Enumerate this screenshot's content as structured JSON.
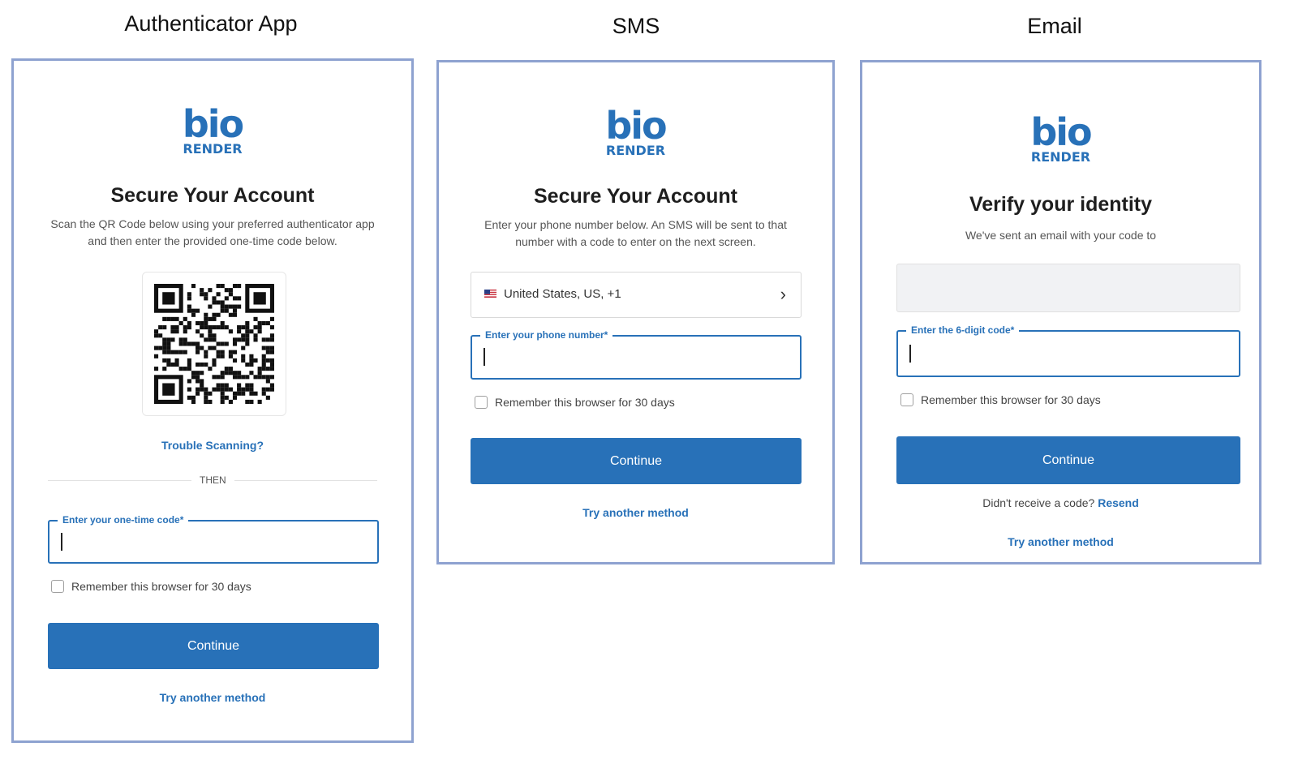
{
  "columns": {
    "authenticator": {
      "title": "Authenticator App",
      "logo": {
        "word": "bio",
        "sub": "RENDER"
      },
      "heading": "Secure Your Account",
      "description": "Scan the QR Code below using your preferred authenticator app and then enter the provided one-time code below.",
      "trouble_link": "Trouble Scanning?",
      "divider_text": "THEN",
      "code_field_label": "Enter your one-time code*",
      "remember_label": "Remember this browser for 30 days",
      "continue_label": "Continue",
      "another_method_link": "Try another method"
    },
    "sms": {
      "title": "SMS",
      "logo": {
        "word": "bio",
        "sub": "RENDER"
      },
      "heading": "Secure Your Account",
      "description": "Enter your phone number below. An SMS will be sent to that number with a code to enter on the next screen.",
      "country_select": "United States, US, +1",
      "phone_field_label": "Enter your phone number*",
      "remember_label": "Remember this browser for 30 days",
      "continue_label": "Continue",
      "another_method_link": "Try another method"
    },
    "email": {
      "title": "Email",
      "logo": {
        "word": "bio",
        "sub": "RENDER"
      },
      "heading": "Verify your identity",
      "description": "We've sent an email with your code to",
      "code_field_label": "Enter the 6-digit code*",
      "remember_label": "Remember this browser for 30 days",
      "continue_label": "Continue",
      "resend_prompt": "Didn't receive a code?",
      "resend_link": "Resend",
      "another_method_link": "Try another method"
    }
  },
  "colors": {
    "brand": "#2871b8",
    "panel_border": "#8ea2d0"
  },
  "icons": [
    "qr-code-icon",
    "us-flag-icon",
    "chevron-right-icon"
  ]
}
